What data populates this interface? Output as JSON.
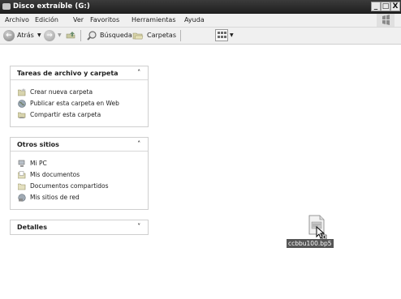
{
  "window": {
    "title": "Disco extraíble (G:)",
    "controls": {
      "minimize": "_",
      "maximize": "□",
      "close": "X"
    }
  },
  "menubar": {
    "items": [
      {
        "label": "Archivo"
      },
      {
        "label": "Edición"
      },
      {
        "label": "Ver"
      },
      {
        "label": "Favoritos"
      },
      {
        "label": "Herramientas"
      },
      {
        "label": "Ayuda"
      }
    ]
  },
  "toolbar": {
    "back_label": "Atrás",
    "search_label": "Búsqueda",
    "folders_label": "Carpetas"
  },
  "panes": {
    "tasks": {
      "title": "Tareas de archivo y carpeta",
      "items": [
        {
          "label": "Crear nueva carpeta",
          "icon": "new-folder-icon"
        },
        {
          "label": "Publicar esta carpeta en Web",
          "icon": "globe-icon"
        },
        {
          "label": "Compartir esta carpeta",
          "icon": "share-folder-icon"
        }
      ]
    },
    "other_places": {
      "title": "Otros sitios",
      "items": [
        {
          "label": "Mi PC",
          "icon": "computer-icon"
        },
        {
          "label": "Mis documentos",
          "icon": "documents-icon"
        },
        {
          "label": "Documentos compartidos",
          "icon": "shared-documents-icon"
        },
        {
          "label": "Mis sitios de red",
          "icon": "network-icon"
        }
      ]
    },
    "details": {
      "title": "Detalles"
    }
  },
  "file": {
    "name": "ccbbu100.bp5",
    "icon": "document-file-icon"
  }
}
